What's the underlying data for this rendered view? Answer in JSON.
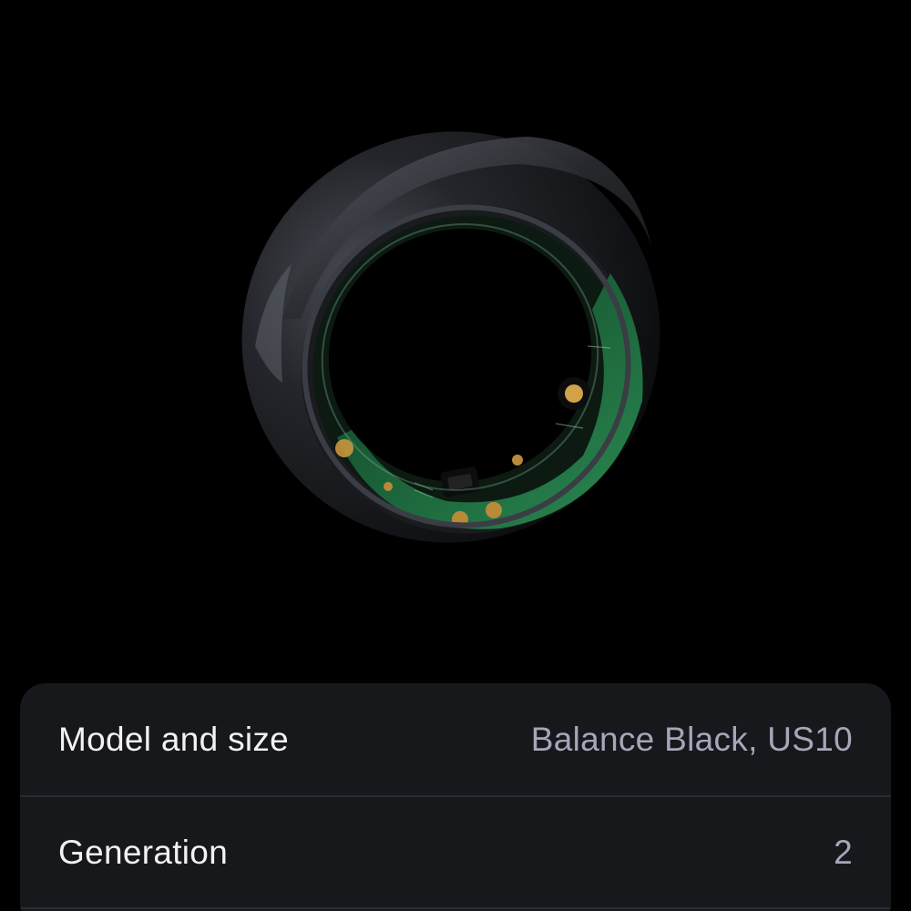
{
  "product": {
    "image_icon": "smart-ring-image"
  },
  "details": {
    "rows": [
      {
        "label": "Model and size",
        "value": "Balance Black, US10"
      },
      {
        "label": "Generation",
        "value": "2"
      }
    ]
  },
  "colors": {
    "background": "#000000",
    "card": "#17181c",
    "label_text": "#f2f2f4",
    "value_text": "#a3a7b8",
    "circuit_green": "#1f6b3f"
  }
}
